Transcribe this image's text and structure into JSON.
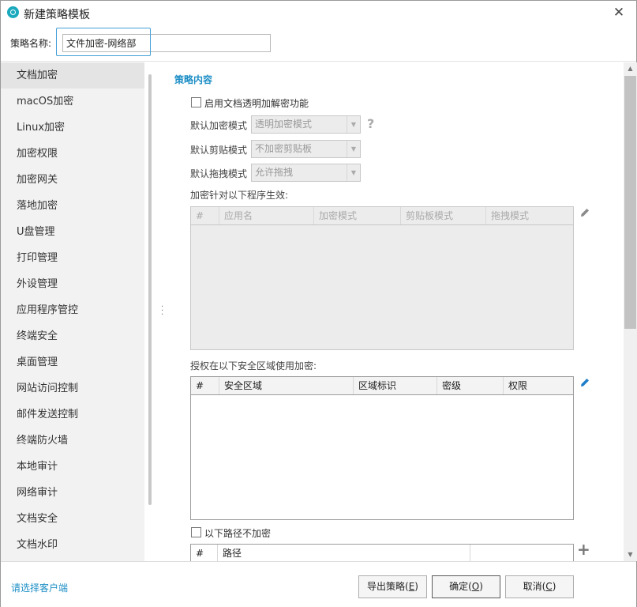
{
  "window": {
    "title": "新建策略模板",
    "close": "✕"
  },
  "name_field": {
    "label": "策略名称:",
    "value": "文件加密-网络部"
  },
  "sidebar": {
    "items": [
      {
        "label": "文档加密"
      },
      {
        "label": "macOS加密"
      },
      {
        "label": "Linux加密"
      },
      {
        "label": "加密权限"
      },
      {
        "label": "加密网关"
      },
      {
        "label": "落地加密"
      },
      {
        "label": "U盘管理"
      },
      {
        "label": "打印管理"
      },
      {
        "label": "外设管理"
      },
      {
        "label": "应用程序管控"
      },
      {
        "label": "终端安全"
      },
      {
        "label": "桌面管理"
      },
      {
        "label": "网站访问控制"
      },
      {
        "label": "邮件发送控制"
      },
      {
        "label": "终端防火墙"
      },
      {
        "label": "本地审计"
      },
      {
        "label": "网络审计"
      },
      {
        "label": "文档安全"
      },
      {
        "label": "文档水印"
      }
    ],
    "active": "文档加密"
  },
  "content": {
    "section_title": "策略内容",
    "enable_checkbox": {
      "label": "启用文档透明加解密功能",
      "checked": false
    },
    "encrypt_mode": {
      "label": "默认加密模式",
      "value": "透明加密模式"
    },
    "clipboard_mode": {
      "label": "默认剪贴模式",
      "value": "不加密剪贴板"
    },
    "drag_mode": {
      "label": "默认拖拽模式",
      "value": "允许拖拽"
    },
    "help_icon": "?",
    "programs_table": {
      "label": "加密针对以下程序生效:",
      "columns": [
        "#",
        "应用名",
        "加密模式",
        "剪贴板模式",
        "拖拽模式"
      ]
    },
    "zones_table": {
      "label": "授权在以下安全区域使用加密:",
      "columns": [
        "#",
        "安全区域",
        "区域标识",
        "密级",
        "权限"
      ]
    },
    "exclude_paths": {
      "label": "以下路径不加密",
      "checked": false
    },
    "paths_table": {
      "columns": [
        "#",
        "路径"
      ]
    }
  },
  "footer": {
    "client_link": "请选择客户端",
    "export_button": {
      "text": "导出策略(",
      "key": "E",
      "close": ")"
    },
    "ok_button": {
      "text": "确定(",
      "key": "O",
      "close": ")"
    },
    "cancel_button": {
      "text": "取消(",
      "key": "C",
      "close": ")"
    }
  },
  "colors": {
    "accent": "#1e8fc6",
    "app_icon": "#1aa9bd",
    "edit_icon": "#1e7ec8"
  }
}
